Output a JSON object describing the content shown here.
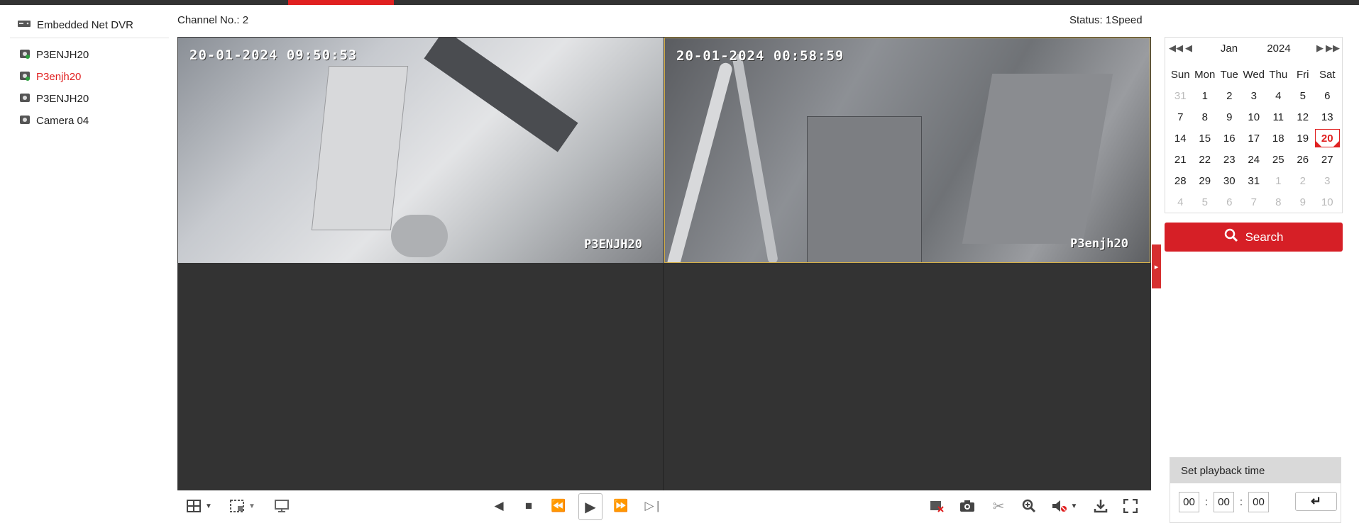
{
  "tree": {
    "device_label": "Embedded Net DVR",
    "cameras": [
      {
        "label": "P3ENJH20",
        "active": false
      },
      {
        "label": "P3enjh20",
        "active": true
      },
      {
        "label": "P3ENJH20",
        "active": false
      },
      {
        "label": "Camera 04",
        "active": false
      }
    ]
  },
  "header": {
    "channel": "Channel No.: 2",
    "status": "Status: 1Speed"
  },
  "panes": [
    {
      "timestamp": "20-01-2024 09:50:53",
      "name": "P3ENJH20"
    },
    {
      "timestamp": "20-01-2024 00:58:59",
      "name": "P3enjh20"
    }
  ],
  "calendar": {
    "month": "Jan",
    "year": "2024",
    "weekdays": [
      "Sun",
      "Mon",
      "Tue",
      "Wed",
      "Thu",
      "Fri",
      "Sat"
    ],
    "weeks": [
      [
        "31",
        "1",
        "2",
        "3",
        "4",
        "5",
        "6"
      ],
      [
        "7",
        "8",
        "9",
        "10",
        "11",
        "12",
        "13"
      ],
      [
        "14",
        "15",
        "16",
        "17",
        "18",
        "19",
        "20"
      ],
      [
        "21",
        "22",
        "23",
        "24",
        "25",
        "26",
        "27"
      ],
      [
        "28",
        "29",
        "30",
        "31",
        "1",
        "2",
        "3"
      ],
      [
        "4",
        "5",
        "6",
        "7",
        "8",
        "9",
        "10"
      ]
    ],
    "selected_day": "20"
  },
  "search": {
    "label": "Search"
  },
  "playback": {
    "title": "Set playback time",
    "hh": "00",
    "mm": "00",
    "ss": "00"
  },
  "colors": {
    "accent": "#d61f26",
    "dark": "#333333",
    "selected_border": "#d6b14b"
  }
}
